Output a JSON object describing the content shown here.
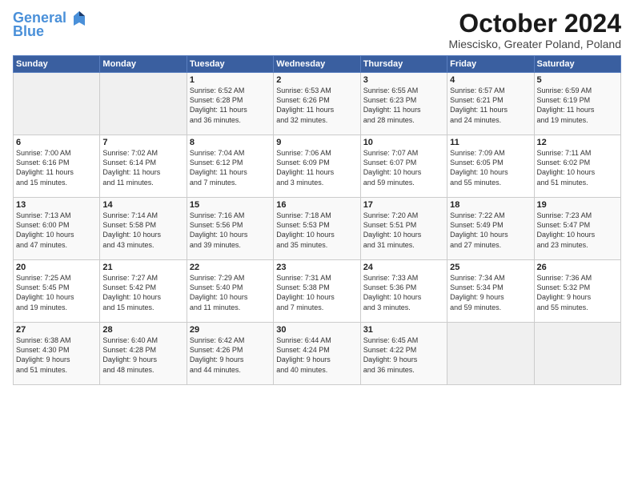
{
  "logo": {
    "line1": "General",
    "line2": "Blue"
  },
  "title": "October 2024",
  "subtitle": "Miescisko, Greater Poland, Poland",
  "weekdays": [
    "Sunday",
    "Monday",
    "Tuesday",
    "Wednesday",
    "Thursday",
    "Friday",
    "Saturday"
  ],
  "weeks": [
    [
      {
        "day": "",
        "info": ""
      },
      {
        "day": "",
        "info": ""
      },
      {
        "day": "1",
        "info": "Sunrise: 6:52 AM\nSunset: 6:28 PM\nDaylight: 11 hours\nand 36 minutes."
      },
      {
        "day": "2",
        "info": "Sunrise: 6:53 AM\nSunset: 6:26 PM\nDaylight: 11 hours\nand 32 minutes."
      },
      {
        "day": "3",
        "info": "Sunrise: 6:55 AM\nSunset: 6:23 PM\nDaylight: 11 hours\nand 28 minutes."
      },
      {
        "day": "4",
        "info": "Sunrise: 6:57 AM\nSunset: 6:21 PM\nDaylight: 11 hours\nand 24 minutes."
      },
      {
        "day": "5",
        "info": "Sunrise: 6:59 AM\nSunset: 6:19 PM\nDaylight: 11 hours\nand 19 minutes."
      }
    ],
    [
      {
        "day": "6",
        "info": "Sunrise: 7:00 AM\nSunset: 6:16 PM\nDaylight: 11 hours\nand 15 minutes."
      },
      {
        "day": "7",
        "info": "Sunrise: 7:02 AM\nSunset: 6:14 PM\nDaylight: 11 hours\nand 11 minutes."
      },
      {
        "day": "8",
        "info": "Sunrise: 7:04 AM\nSunset: 6:12 PM\nDaylight: 11 hours\nand 7 minutes."
      },
      {
        "day": "9",
        "info": "Sunrise: 7:06 AM\nSunset: 6:09 PM\nDaylight: 11 hours\nand 3 minutes."
      },
      {
        "day": "10",
        "info": "Sunrise: 7:07 AM\nSunset: 6:07 PM\nDaylight: 10 hours\nand 59 minutes."
      },
      {
        "day": "11",
        "info": "Sunrise: 7:09 AM\nSunset: 6:05 PM\nDaylight: 10 hours\nand 55 minutes."
      },
      {
        "day": "12",
        "info": "Sunrise: 7:11 AM\nSunset: 6:02 PM\nDaylight: 10 hours\nand 51 minutes."
      }
    ],
    [
      {
        "day": "13",
        "info": "Sunrise: 7:13 AM\nSunset: 6:00 PM\nDaylight: 10 hours\nand 47 minutes."
      },
      {
        "day": "14",
        "info": "Sunrise: 7:14 AM\nSunset: 5:58 PM\nDaylight: 10 hours\nand 43 minutes."
      },
      {
        "day": "15",
        "info": "Sunrise: 7:16 AM\nSunset: 5:56 PM\nDaylight: 10 hours\nand 39 minutes."
      },
      {
        "day": "16",
        "info": "Sunrise: 7:18 AM\nSunset: 5:53 PM\nDaylight: 10 hours\nand 35 minutes."
      },
      {
        "day": "17",
        "info": "Sunrise: 7:20 AM\nSunset: 5:51 PM\nDaylight: 10 hours\nand 31 minutes."
      },
      {
        "day": "18",
        "info": "Sunrise: 7:22 AM\nSunset: 5:49 PM\nDaylight: 10 hours\nand 27 minutes."
      },
      {
        "day": "19",
        "info": "Sunrise: 7:23 AM\nSunset: 5:47 PM\nDaylight: 10 hours\nand 23 minutes."
      }
    ],
    [
      {
        "day": "20",
        "info": "Sunrise: 7:25 AM\nSunset: 5:45 PM\nDaylight: 10 hours\nand 19 minutes."
      },
      {
        "day": "21",
        "info": "Sunrise: 7:27 AM\nSunset: 5:42 PM\nDaylight: 10 hours\nand 15 minutes."
      },
      {
        "day": "22",
        "info": "Sunrise: 7:29 AM\nSunset: 5:40 PM\nDaylight: 10 hours\nand 11 minutes."
      },
      {
        "day": "23",
        "info": "Sunrise: 7:31 AM\nSunset: 5:38 PM\nDaylight: 10 hours\nand 7 minutes."
      },
      {
        "day": "24",
        "info": "Sunrise: 7:33 AM\nSunset: 5:36 PM\nDaylight: 10 hours\nand 3 minutes."
      },
      {
        "day": "25",
        "info": "Sunrise: 7:34 AM\nSunset: 5:34 PM\nDaylight: 9 hours\nand 59 minutes."
      },
      {
        "day": "26",
        "info": "Sunrise: 7:36 AM\nSunset: 5:32 PM\nDaylight: 9 hours\nand 55 minutes."
      }
    ],
    [
      {
        "day": "27",
        "info": "Sunrise: 6:38 AM\nSunset: 4:30 PM\nDaylight: 9 hours\nand 51 minutes."
      },
      {
        "day": "28",
        "info": "Sunrise: 6:40 AM\nSunset: 4:28 PM\nDaylight: 9 hours\nand 48 minutes."
      },
      {
        "day": "29",
        "info": "Sunrise: 6:42 AM\nSunset: 4:26 PM\nDaylight: 9 hours\nand 44 minutes."
      },
      {
        "day": "30",
        "info": "Sunrise: 6:44 AM\nSunset: 4:24 PM\nDaylight: 9 hours\nand 40 minutes."
      },
      {
        "day": "31",
        "info": "Sunrise: 6:45 AM\nSunset: 4:22 PM\nDaylight: 9 hours\nand 36 minutes."
      },
      {
        "day": "",
        "info": ""
      },
      {
        "day": "",
        "info": ""
      }
    ]
  ]
}
